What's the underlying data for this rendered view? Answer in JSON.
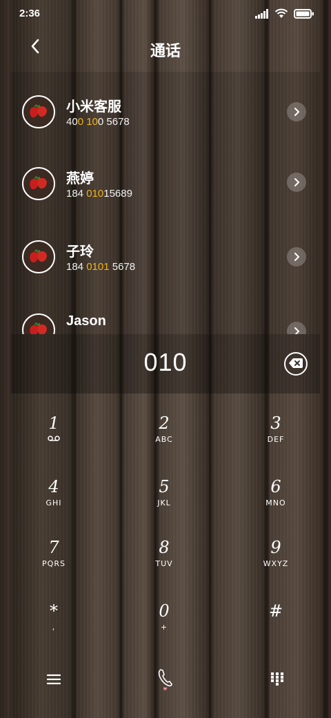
{
  "status": {
    "time": "2:36"
  },
  "header": {
    "title": "通话"
  },
  "contacts": [
    {
      "name": "小米客服",
      "num_parts": [
        "40",
        "0 10",
        "0 5678"
      ]
    },
    {
      "name": "燕婷",
      "num_parts": [
        "184 ",
        "010",
        "15689"
      ]
    },
    {
      "name": "子玲",
      "num_parts": [
        "184 ",
        "0101",
        " 5678"
      ]
    },
    {
      "name": "Jason",
      "num_parts": [
        "",
        "",
        ""
      ]
    }
  ],
  "dial": {
    "digits": "010"
  },
  "keypad": [
    {
      "num": "1",
      "sub": ""
    },
    {
      "num": "2",
      "sub": "ABC"
    },
    {
      "num": "3",
      "sub": "DEF"
    },
    {
      "num": "4",
      "sub": "GHI"
    },
    {
      "num": "5",
      "sub": "JKL"
    },
    {
      "num": "6",
      "sub": "MNO"
    },
    {
      "num": "7",
      "sub": "PQRS"
    },
    {
      "num": "8",
      "sub": "TUV"
    },
    {
      "num": "9",
      "sub": "WXYZ"
    },
    {
      "num": "*",
      "sub": ","
    },
    {
      "num": "0",
      "sub": "+"
    },
    {
      "num": "#",
      "sub": ""
    }
  ],
  "colors": {
    "highlight": "#f2b21b",
    "text": "#ffffff"
  },
  "icons": {
    "key1_sub": "voicemail-icon",
    "menu": "menu-icon",
    "call": "phone-icon",
    "keypad": "dialpad-icon",
    "delete": "backspace-icon"
  }
}
